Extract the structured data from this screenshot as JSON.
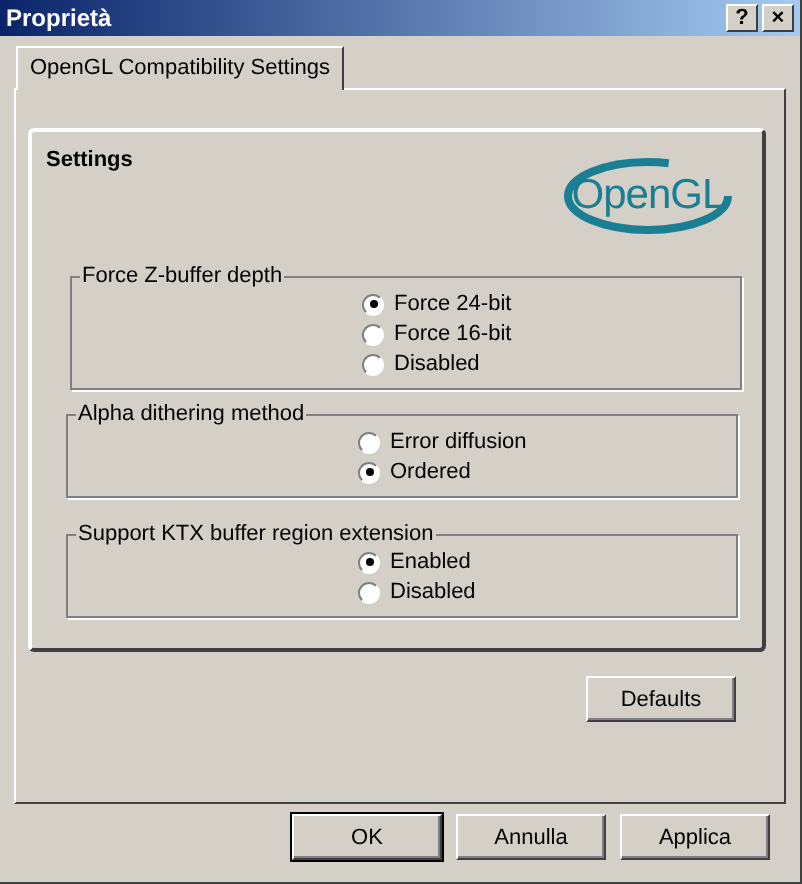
{
  "window": {
    "title": "Proprietà",
    "help_button": "?",
    "close_button": "×"
  },
  "tabs": [
    {
      "label": "OpenGL Compatibility Settings",
      "selected": true
    }
  ],
  "panel": {
    "title": "Settings",
    "logo": "OpenGL",
    "groups": [
      {
        "label": "Force Z-buffer depth",
        "options": [
          {
            "label": "Force 24-bit",
            "selected": true
          },
          {
            "label": "Force 16-bit",
            "selected": false
          },
          {
            "label": "Disabled",
            "selected": false
          }
        ]
      },
      {
        "label": "Alpha dithering method",
        "options": [
          {
            "label": "Error diffusion",
            "selected": false
          },
          {
            "label": "Ordered",
            "selected": true
          }
        ]
      },
      {
        "label": "Support KTX buffer region extension",
        "options": [
          {
            "label": "Enabled",
            "selected": true
          },
          {
            "label": "Disabled",
            "selected": false
          }
        ]
      }
    ]
  },
  "defaults_button": "Defaults",
  "buttons": [
    {
      "label": "OK",
      "default": true
    },
    {
      "label": "Annulla",
      "default": false
    },
    {
      "label": "Applica",
      "default": false
    }
  ]
}
